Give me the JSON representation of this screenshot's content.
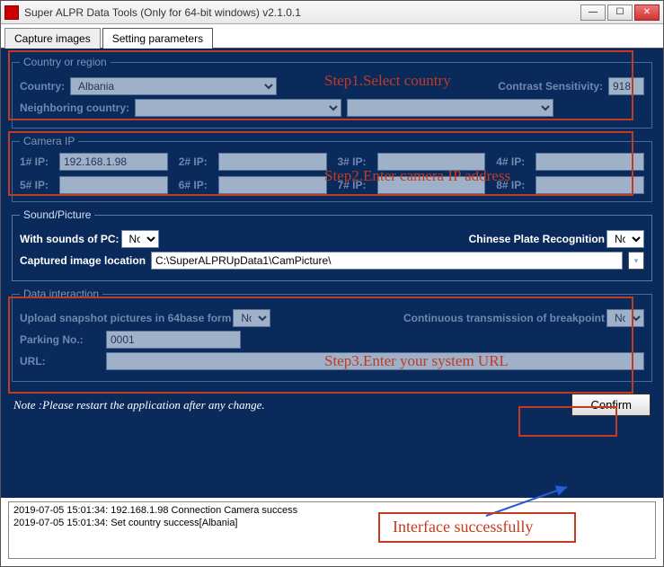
{
  "window": {
    "title": "Super ALPR Data Tools  (Only for 64-bit windows)     v2.1.0.1"
  },
  "tabs": {
    "capture": "Capture images",
    "settings": "Setting parameters"
  },
  "country_region": {
    "legend": "Country or region",
    "country_label": "Country:",
    "country_value": "Albania",
    "sensitivity_label": "Contrast Sensitivity:",
    "sensitivity_value": "918",
    "neighbor_label": "Neighboring country:"
  },
  "camera_ip": {
    "legend": "Camera IP",
    "ips": [
      {
        "label": "1# IP:",
        "value": "192.168.1.98"
      },
      {
        "label": "2# IP:",
        "value": ""
      },
      {
        "label": "3# IP:",
        "value": ""
      },
      {
        "label": "4# IP:",
        "value": ""
      },
      {
        "label": "5# IP:",
        "value": ""
      },
      {
        "label": "6# IP:",
        "value": ""
      },
      {
        "label": "7# IP:",
        "value": ""
      },
      {
        "label": "8# IP:",
        "value": ""
      }
    ]
  },
  "sound_picture": {
    "legend": "Sound/Picture",
    "sounds_label": "With sounds of  PC:",
    "sounds_value": "No",
    "chinese_label": "Chinese Plate Recognition",
    "chinese_value": "No",
    "location_label": "Captured image location",
    "location_value": "C:\\SuperALPRUpData1\\CamPicture\\"
  },
  "data_interaction": {
    "legend": "Data interaction",
    "upload_label": "Upload snapshot pictures in 64base form",
    "upload_value": "No",
    "continuous_label": "Continuous transmission of breakpoint",
    "continuous_value": "No",
    "parking_label": "Parking No.:",
    "parking_value": "0001",
    "url_label": "URL:",
    "url_value": ""
  },
  "note": "Note :Please restart the application after any change.",
  "confirm_label": "Confirm",
  "log": {
    "line1": "2019-07-05 15:01:34: 192.168.1.98 Connection Camera success",
    "line2": "2019-07-05 15:01:34: Set country success[Albania]"
  },
  "annotations": {
    "step1": "Step1.Select country",
    "step2": "Step2.Enter camera IP address",
    "step3": "Step3.Enter your system URL",
    "success": "Interface successfully"
  }
}
